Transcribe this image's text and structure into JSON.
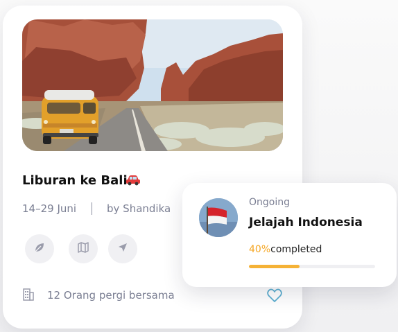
{
  "trip_card": {
    "title": "Liburan ke Bali",
    "title_emoji_icon": "car-icon",
    "dates": "14–29 Juni",
    "organizer": "by Shandika",
    "actions": [
      {
        "icon": "leaf-icon"
      },
      {
        "icon": "map-icon"
      },
      {
        "icon": "send-icon"
      }
    ],
    "people_text": "12 Orang pergi bersama",
    "people_icon": "building-icon",
    "favorite_icon": "heart-icon"
  },
  "status_card": {
    "status": "Ongoing",
    "title": "Jelajah Indonesia",
    "progress_value": "40%",
    "progress_suffix": "completed",
    "progress_fraction": 0.4,
    "avatar_icon": "indonesia-flag-icon"
  },
  "colors": {
    "accent": "#f5b236",
    "muted_text": "#7b7f93",
    "heart": "#5aaed0"
  }
}
